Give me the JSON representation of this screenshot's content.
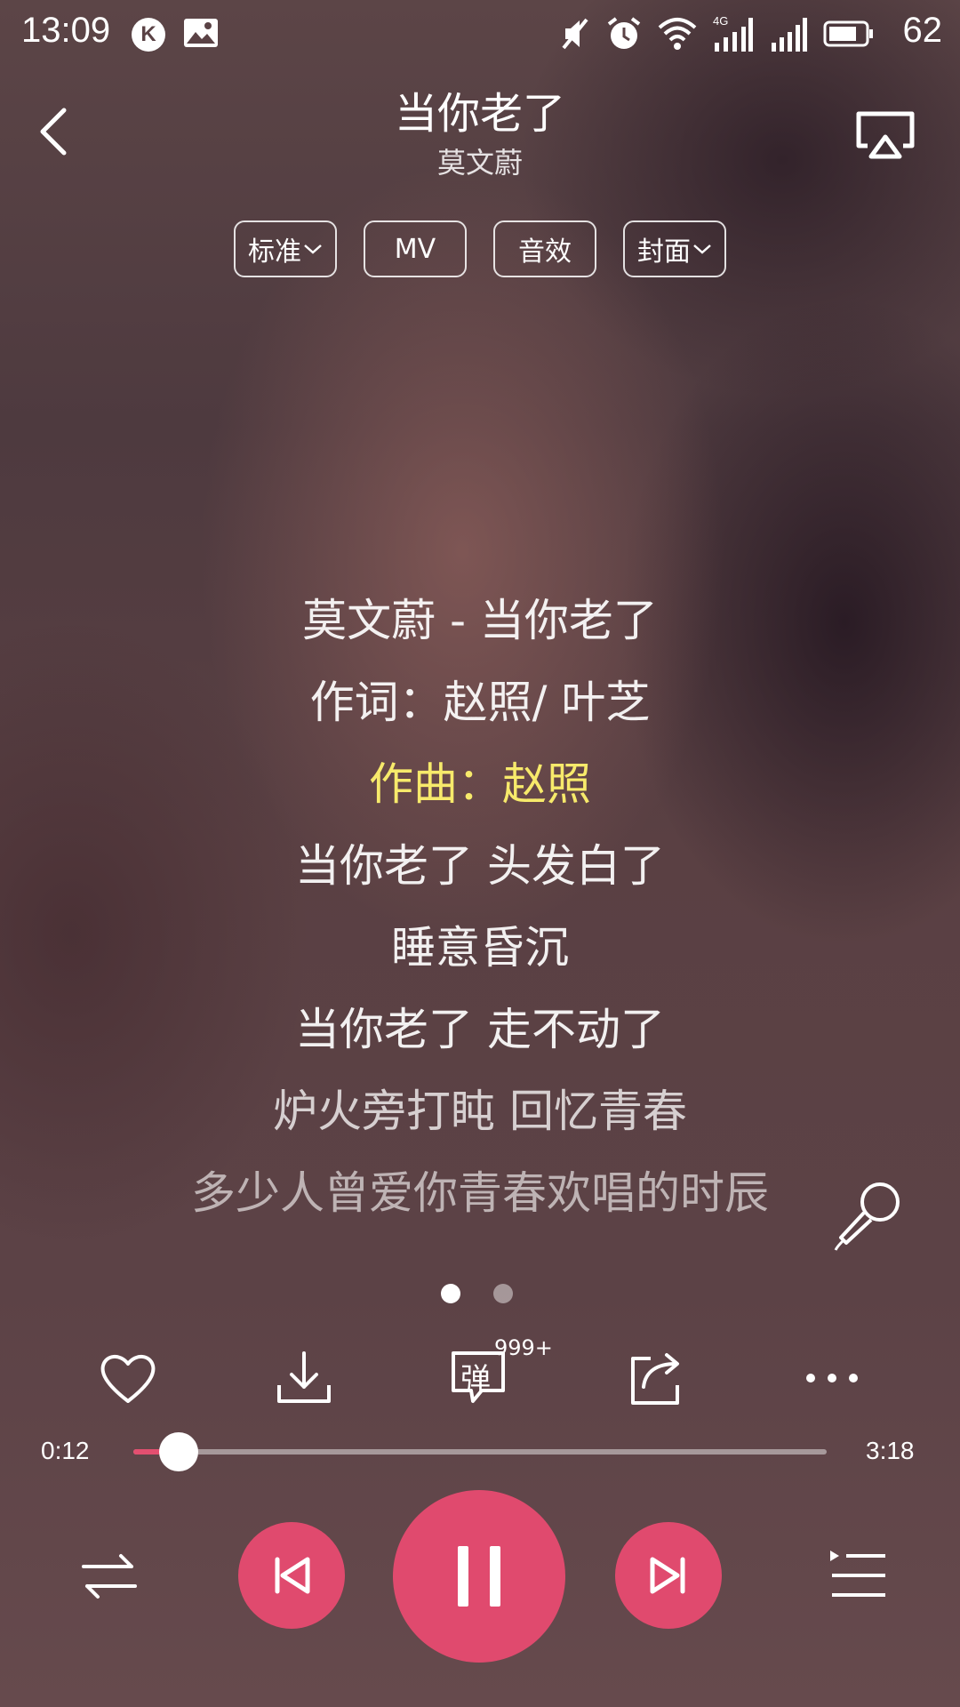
{
  "status_bar": {
    "time": "13:09",
    "app_icon_letter": "K",
    "battery": "62",
    "icons": [
      "k-icon",
      "image-icon",
      "mute-icon",
      "alarm-icon",
      "wifi-icon",
      "signal-4g-icon",
      "signal-icon",
      "battery-icon"
    ]
  },
  "header": {
    "title": "当你老了",
    "artist": "莫文蔚"
  },
  "chips": [
    {
      "label": "标准",
      "dropdown": true
    },
    {
      "label": "MV",
      "dropdown": false
    },
    {
      "label": "音效",
      "dropdown": false
    },
    {
      "label": "封面",
      "dropdown": true
    }
  ],
  "lyrics": [
    "莫文蔚 - 当你老了",
    "作词：赵照/ 叶芝",
    "作曲：赵照",
    "当你老了 头发白了",
    "睡意昏沉",
    "当你老了 走不动了",
    "炉火旁打盹 回忆青春",
    "多少人曾爱你青春欢唱的时辰"
  ],
  "active_lyric_index": 2,
  "pager": {
    "pages": 2,
    "current": 1
  },
  "actions": {
    "danmaku_label": "弹",
    "danmaku_badge": "999+"
  },
  "progress": {
    "current": "0:12",
    "duration": "3:18",
    "fraction": 0.065
  },
  "colors": {
    "accent": "#e04a6e",
    "active_lyric": "#f7ea6b"
  }
}
